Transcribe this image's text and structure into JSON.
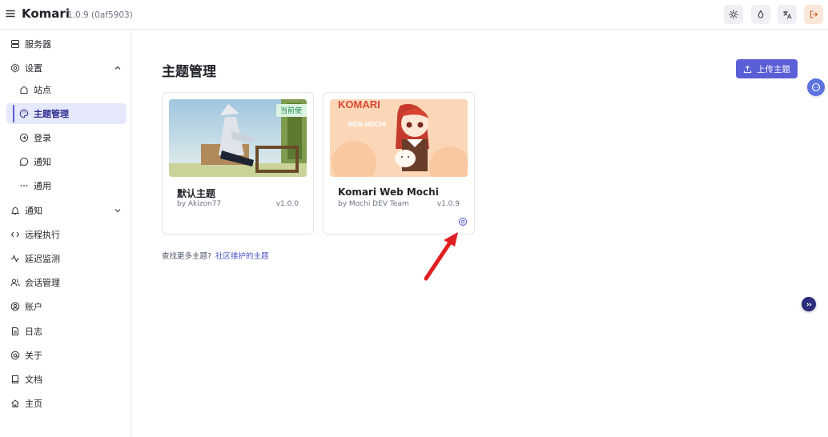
{
  "app": {
    "title": "Komari",
    "version": "1.0.9 (0af5903)"
  },
  "top_actions": [
    {
      "icon": "sun-icon"
    },
    {
      "icon": "drop-icon"
    },
    {
      "icon": "translate-icon"
    },
    {
      "icon": "logout-icon"
    }
  ],
  "sidebar": {
    "items": [
      {
        "label": "服务器",
        "icon": "server-icon"
      },
      {
        "label": "设置",
        "icon": "settings-icon",
        "expanded": true
      },
      {
        "label": "站点",
        "icon": "home-icon"
      },
      {
        "label": "主题管理",
        "icon": "palette-icon",
        "active": true
      },
      {
        "label": "登录",
        "icon": "login-icon"
      },
      {
        "label": "通知",
        "icon": "message-icon"
      },
      {
        "label": "通用",
        "icon": "dots-icon"
      },
      {
        "label": "通知",
        "icon": "bell-icon",
        "expanded": false
      },
      {
        "label": "远程执行",
        "icon": "code-icon"
      },
      {
        "label": "延迟监测",
        "icon": "activity-icon"
      },
      {
        "label": "会话管理",
        "icon": "users-icon"
      },
      {
        "label": "账户",
        "icon": "user-circle-icon"
      },
      {
        "label": "日志",
        "icon": "file-icon"
      },
      {
        "label": "关于",
        "icon": "at-icon"
      },
      {
        "label": "文档",
        "icon": "book-icon"
      },
      {
        "label": "主页",
        "icon": "house-icon"
      }
    ]
  },
  "main": {
    "title": "主题管理",
    "upload_label": "上传主题",
    "themes": [
      {
        "name": "默认主题",
        "author": "by Akizon77",
        "version": "v1.0.0",
        "badge": "当前使"
      },
      {
        "name": "Komari Web Mochi",
        "author": "by Mochi DEV Team",
        "version": "v1.0.9",
        "banner": "KOMARI",
        "banner_sub": "WEB-MOCHI"
      }
    ],
    "more_text": "查找更多主题?",
    "more_link": "社区维护的主题"
  },
  "colors": {
    "accent": "#5b5fd6",
    "active_bg": "#e6e8fb",
    "badge_bg": "#dcf3e2",
    "annotation_arrow": "#e02020"
  }
}
